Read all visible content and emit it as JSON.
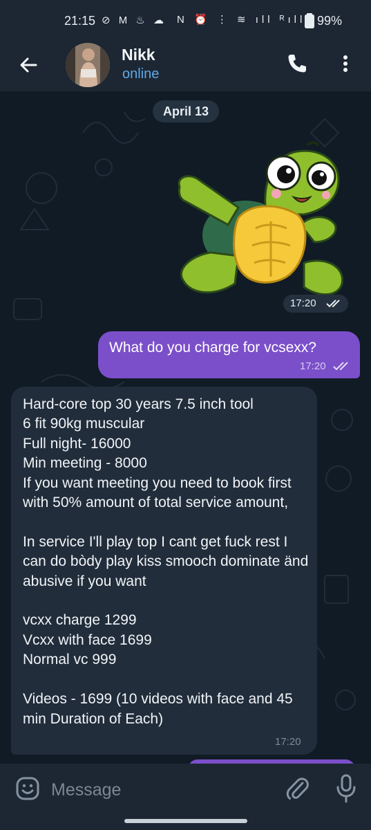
{
  "status_bar": {
    "time": "21:15",
    "left_icons": "⊘ M ♨ ☁",
    "right_icons": "N ⏰ ⋮ ≋ ıll ᴿıll",
    "battery": "99%"
  },
  "header": {
    "contact_name": "Nikk",
    "contact_status": "online",
    "icons": [
      "back-arrow-icon",
      "phone-icon",
      "more-vert-icon"
    ]
  },
  "chat": {
    "date_label": "April 13",
    "sticker": {
      "description_icon": "turtle-sticker",
      "time": "17:20",
      "read": true
    },
    "outgoing": {
      "text": "What do you charge for vcsexx?",
      "time": "17:20",
      "read": true
    },
    "incoming": {
      "text": "Hard-core top 30 years 7.5 inch tool\n6 fit 90kg muscular\nFull night- 16000\nMin meeting - 8000\nIf you want meeting you need to book first with 50% amount of total service amount,\n\nIn service I'll play top I cant get fuck rest I can do bòdy play kiss smooch dominate änd abusive if you want\n\nvcxx charge 1299\nVcxx with face 1699\nNormal vc 999\n\nVideos - 1699 (10 videos with face and 45 min Duration of Each)",
      "time": "17:20"
    }
  },
  "input_bar": {
    "placeholder": "Message",
    "icons": [
      "emoji-icon",
      "paperclip-icon",
      "microphone-icon"
    ]
  },
  "colors": {
    "header_bg": "#1d2733",
    "chat_bg": "#111b26",
    "outgoing_bubble": "#7b4fc9",
    "incoming_bubble": "#212d3b",
    "status_online": "#5fa9e8"
  }
}
